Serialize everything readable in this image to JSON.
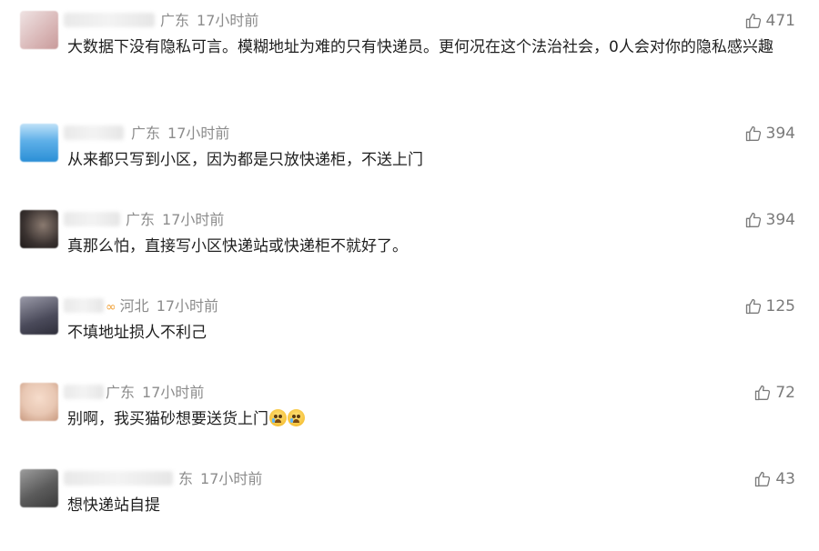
{
  "comments": [
    {
      "region": "广东",
      "time": "17小时前",
      "likes": "471",
      "text": "大数据下没有隐私可言。模糊地址为难的只有快递员。更何况在这个法治社会，0人会对你的隐私感兴趣",
      "avatar_color": "#d9b7b7"
    },
    {
      "region": "广东",
      "time": "17小时前",
      "likes": "394",
      "text": "从来都只写到小区，因为都是只放快递柜，不送上门",
      "avatar_color": "#2b8fd6"
    },
    {
      "region": "广东",
      "time": "17小时前",
      "likes": "394",
      "text": "真那么怕，直接写小区快递站或快递柜不就好了。",
      "avatar_color": "#3a3230"
    },
    {
      "region": "河北",
      "time": "17小时前",
      "likes": "125",
      "text": "不填地址损人不利己",
      "avatar_color": "#4a4a5a"
    },
    {
      "region": "广东",
      "time": "17小时前",
      "likes": "72",
      "text": "别啊，我买猫砂想要送货上门",
      "avatar_color": "#e8c7b3"
    },
    {
      "region": "东",
      "time": "17小时前",
      "likes": "43",
      "text": "想快递站自提",
      "avatar_color": "#5b5b5b"
    }
  ],
  "icons": {
    "like": "thumbs-up-icon",
    "emoji": "crying-face-emoji"
  }
}
